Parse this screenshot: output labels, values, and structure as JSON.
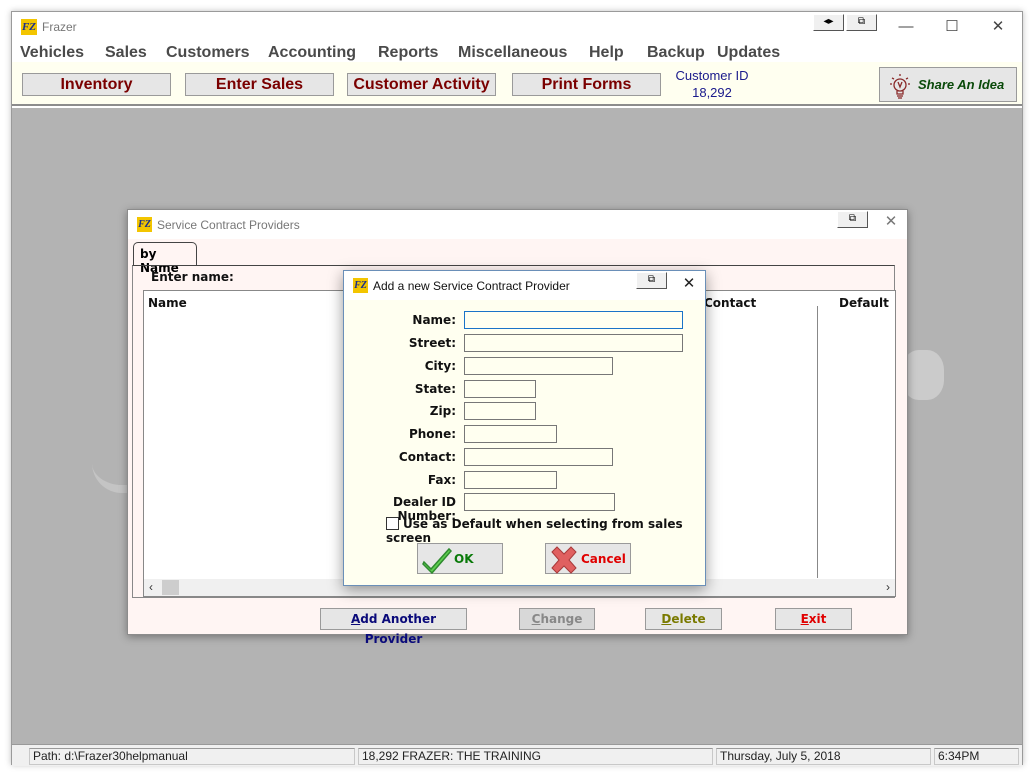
{
  "app": {
    "title": "Frazer",
    "logo_text": "FZ",
    "title_buttons": {
      "resize": "◂▸",
      "restore": "⧉"
    },
    "window_controls": {
      "minimize": "—",
      "maximize": "☐",
      "close": "✕"
    }
  },
  "menu": [
    "Vehicles",
    "Sales",
    "Customers",
    "Accounting",
    "Reports",
    "Miscellaneous",
    "Help",
    "Backup",
    "Updates"
  ],
  "toolbar": {
    "buttons": [
      "Inventory",
      "Enter Sales",
      "Customer Activity",
      "Print Forms"
    ],
    "customer_id_label": "Customer ID",
    "customer_id_value": "18,292",
    "share_label": "Share An Idea"
  },
  "providers_window": {
    "title": "Service Contract Providers",
    "tab_label": "by Name",
    "enter_name_label": "Enter name:",
    "columns": [
      "Name",
      "Contact",
      "Default"
    ],
    "rows": [],
    "buttons": {
      "add": {
        "underline": "A",
        "rest": "dd Another Provider"
      },
      "change": {
        "underline": "C",
        "rest": "hange"
      },
      "delete": {
        "underline": "D",
        "rest": "elete"
      },
      "exit": {
        "underline": "E",
        "rest": "xit"
      }
    },
    "colors": {
      "add": "#0a0a7a",
      "change": "#888888",
      "delete": "#7a7a00",
      "exit": "#e00000"
    }
  },
  "dialog": {
    "title": "Add a new Service Contract Provider",
    "fields": [
      {
        "label": "Name:",
        "value": ""
      },
      {
        "label": "Street:",
        "value": ""
      },
      {
        "label": "City:",
        "value": ""
      },
      {
        "label": "State:",
        "value": ""
      },
      {
        "label": "Zip:",
        "value": ""
      },
      {
        "label": "Phone:",
        "value": ""
      },
      {
        "label": "Contact:",
        "value": ""
      },
      {
        "label": "Fax:",
        "value": ""
      },
      {
        "label": "Dealer ID Number:",
        "value": ""
      }
    ],
    "checkbox_label": "Use as Default when selecting from sales screen",
    "checkbox_checked": false,
    "ok_label": "OK",
    "cancel_label": "Cancel"
  },
  "statusbar": {
    "path": "Path: d:\\Frazer30helpmanual",
    "company": "18,292  FRAZER: THE TRAINING",
    "date": "Thursday, July  5, 2018",
    "time": "6:34PM"
  }
}
